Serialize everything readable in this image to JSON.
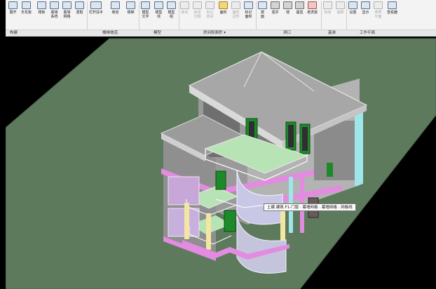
{
  "ribbon": {
    "tools": [
      {
        "label": "展开",
        "label2": "",
        "name": "tool-expand"
      },
      {
        "label": "天花板",
        "label2": "",
        "name": "tool-ceiling"
      },
      {
        "label": "楼板",
        "label2": "",
        "name": "tool-floor"
      },
      {
        "label": "幕墙",
        "label2": "系统",
        "name": "tool-curtain-system"
      },
      {
        "label": "幕墙",
        "label2": "网格",
        "name": "tool-curtain-grid"
      },
      {
        "label": "竖梃",
        "label2": "",
        "name": "tool-mullion"
      },
      {
        "label": "栏杆扶手",
        "label2": "",
        "name": "tool-railing"
      },
      {
        "label": "坡道",
        "label2": "",
        "name": "tool-ramp"
      },
      {
        "label": "楼梯",
        "label2": "",
        "name": "tool-stair"
      },
      {
        "label": "模型",
        "label2": "文字",
        "name": "tool-model-text"
      },
      {
        "label": "模型",
        "label2": "线",
        "name": "tool-model-line"
      },
      {
        "label": "模型",
        "label2": "组",
        "name": "tool-model-group"
      },
      {
        "label": "房间",
        "label2": "",
        "name": "tool-room"
      },
      {
        "label": "房间",
        "label2": "分隔",
        "name": "tool-room-separator"
      },
      {
        "label": "标记",
        "label2": "房间",
        "name": "tool-tag-room"
      },
      {
        "label": "面积",
        "label2": "",
        "name": "tool-area"
      },
      {
        "label": "面积",
        "label2": "边界",
        "name": "tool-area-boundary"
      },
      {
        "label": "标记",
        "label2": "面积",
        "name": "tool-tag-area"
      },
      {
        "label": "按",
        "label2": "面",
        "name": "tool-by-face"
      },
      {
        "label": "竖井",
        "label2": "",
        "name": "tool-shaft"
      },
      {
        "label": "墙",
        "label2": "",
        "name": "tool-wall-opening"
      },
      {
        "label": "垂直",
        "label2": "",
        "name": "tool-vertical"
      },
      {
        "label": "老虎窗",
        "label2": "",
        "name": "tool-dormer"
      },
      {
        "label": "标高",
        "label2": "",
        "name": "tool-level"
      },
      {
        "label": "轴网",
        "label2": "",
        "name": "tool-grid"
      },
      {
        "label": "设置",
        "label2": "",
        "name": "tool-set"
      },
      {
        "label": "显示",
        "label2": "",
        "name": "tool-show"
      },
      {
        "label": "参照",
        "label2": "平面",
        "name": "tool-ref-plane"
      },
      {
        "label": "查看器",
        "label2": "",
        "name": "tool-viewer"
      }
    ],
    "panels": [
      {
        "title": "构建",
        "name": "panel-build"
      },
      {
        "title": "楼梯坡道",
        "name": "panel-circulation"
      },
      {
        "title": "模型",
        "name": "panel-model"
      },
      {
        "title": "房间和面积 ▾",
        "name": "panel-room-area"
      },
      {
        "title": "洞口",
        "name": "panel-opening"
      },
      {
        "title": "基准",
        "name": "panel-datum"
      },
      {
        "title": "工作平面",
        "name": "panel-work-plane"
      }
    ]
  },
  "viewport": {
    "tooltip": "土建.建筑.F1-门窗 : 幕墙网格 : 幕墙网格 : 网格线"
  },
  "colors": {
    "ground": "#5d7a5d",
    "background": "#000000",
    "roof": "#a7a7a7",
    "wall_highlight": "#9fe6ea",
    "accent_magenta": "#e38be0",
    "window_green": "#1d8a2a",
    "floor_green": "#b7e3b5"
  }
}
